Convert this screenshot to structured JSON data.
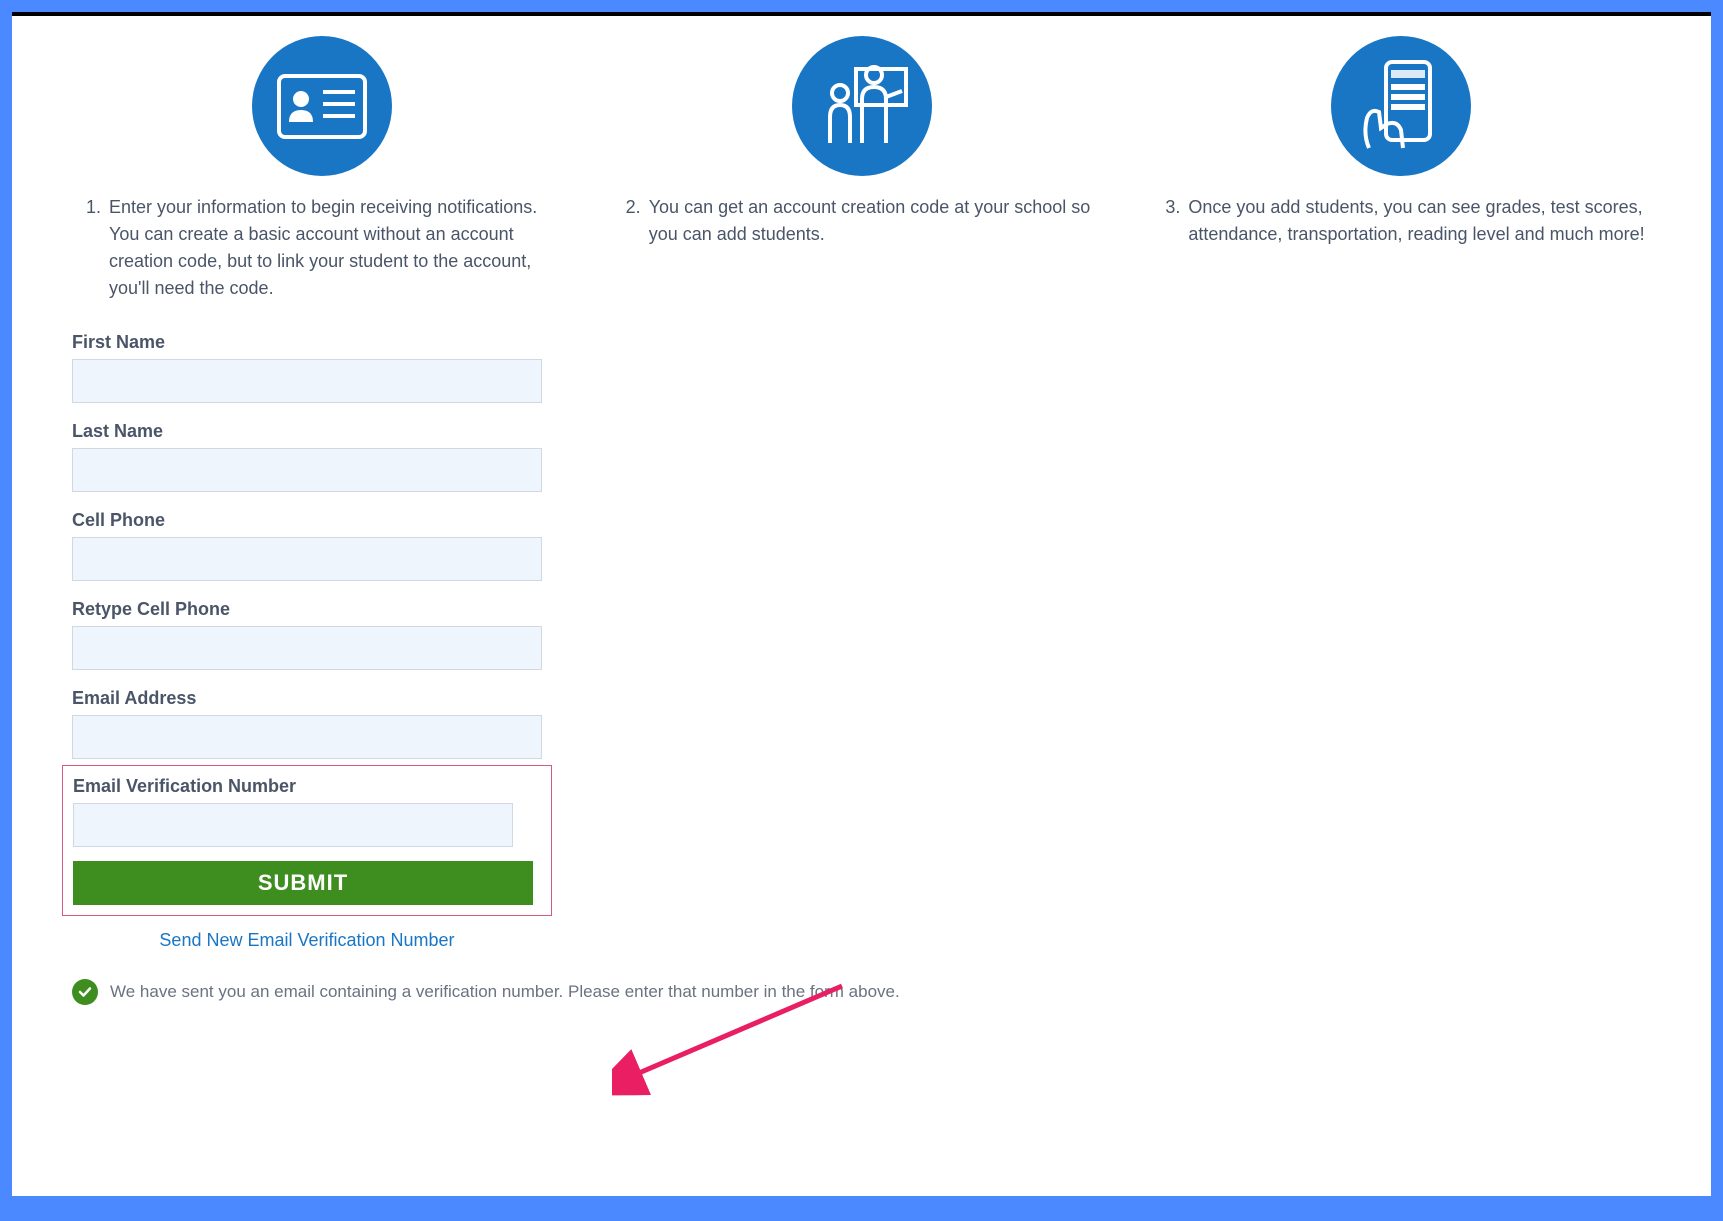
{
  "steps": [
    {
      "num": "1.",
      "desc": "Enter your information to begin receiving notifications. You can create a basic account without an account creation code, but to link your student to the account, you'll need the code."
    },
    {
      "num": "2.",
      "desc": "You can get an account creation code at your school so you can add students."
    },
    {
      "num": "3.",
      "desc": "Once you add students, you can see grades, test scores, attendance, transportation, reading level and much more!"
    }
  ],
  "form": {
    "first_name_label": "First Name",
    "last_name_label": "Last Name",
    "cell_phone_label": "Cell Phone",
    "retype_cell_phone_label": "Retype Cell Phone",
    "email_label": "Email Address",
    "verification_label": "Email Verification Number",
    "submit_label": "SUBMIT",
    "resend_link": "Send New Email Verification Number"
  },
  "status_message": "We have sent you an email containing a verification number. Please enter that number in the form above."
}
